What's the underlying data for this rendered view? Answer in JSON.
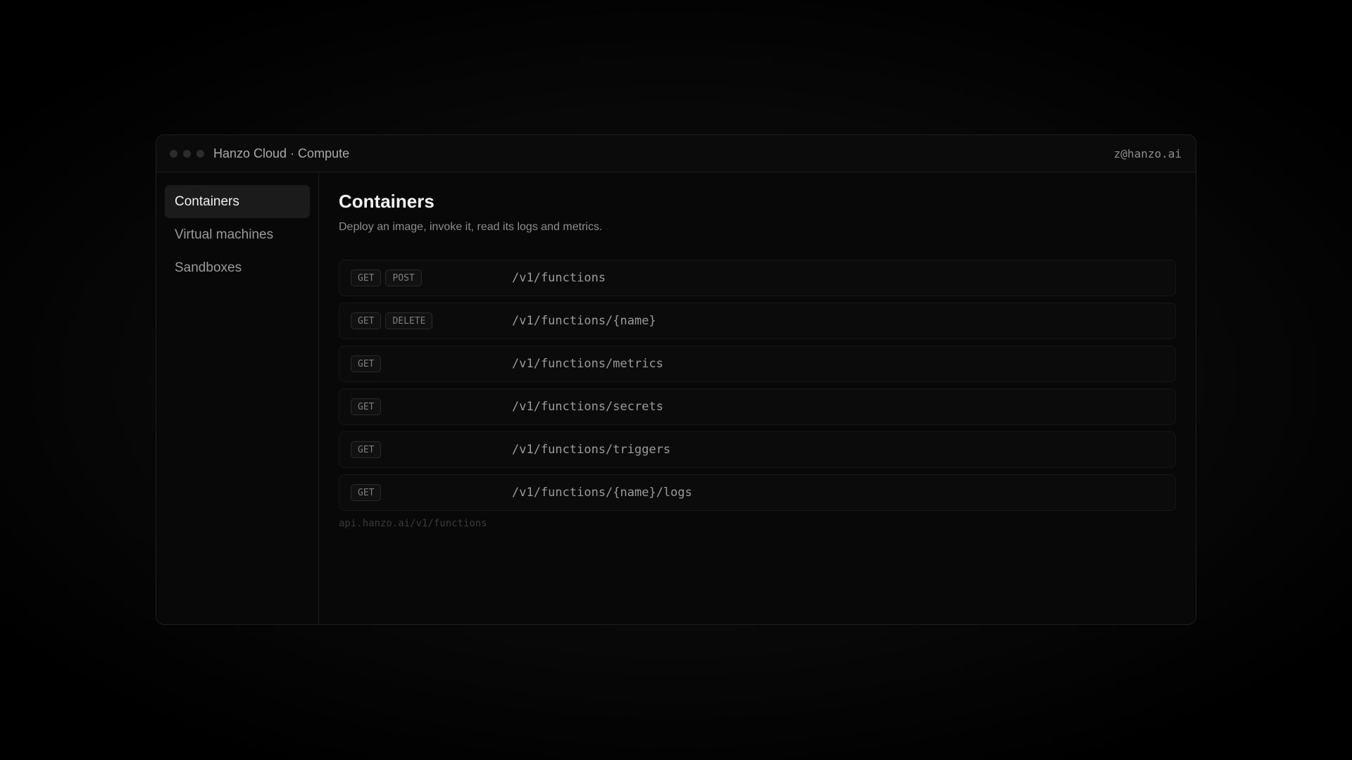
{
  "window": {
    "title": "Hanzo Cloud · Compute",
    "account": "z@hanzo.ai"
  },
  "sidebar": {
    "items": [
      {
        "label": "Containers",
        "active": true
      },
      {
        "label": "Virtual machines",
        "active": false
      },
      {
        "label": "Sandboxes",
        "active": false
      }
    ]
  },
  "main": {
    "title": "Containers",
    "subtitle": "Deploy an image, invoke it, read its logs and metrics.",
    "endpoints": [
      {
        "methods": [
          "GET",
          "POST"
        ],
        "path": "/v1/functions"
      },
      {
        "methods": [
          "GET",
          "DELETE"
        ],
        "path": "/v1/functions/{name}"
      },
      {
        "methods": [
          "GET"
        ],
        "path": "/v1/functions/metrics"
      },
      {
        "methods": [
          "GET"
        ],
        "path": "/v1/functions/secrets"
      },
      {
        "methods": [
          "GET"
        ],
        "path": "/v1/functions/triggers"
      },
      {
        "methods": [
          "GET"
        ],
        "path": "/v1/functions/{name}/logs"
      }
    ],
    "base_url": "api.hanzo.ai/v1/functions"
  },
  "colors": {
    "background": "#000000",
    "window": "#080808",
    "active_nav": "#1b1b1b",
    "text_primary": "#f2f2f2",
    "text_muted": "#8c8c8c"
  }
}
